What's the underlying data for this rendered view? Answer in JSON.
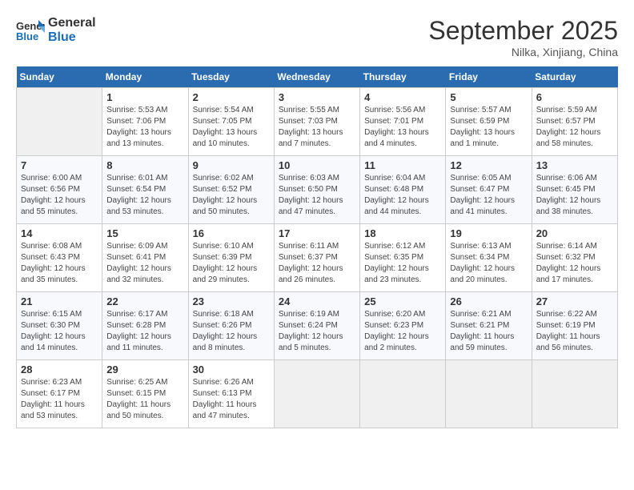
{
  "logo": {
    "line1": "General",
    "line2": "Blue"
  },
  "title": "September 2025",
  "subtitle": "Nilka, Xinjiang, China",
  "days_header": [
    "Sunday",
    "Monday",
    "Tuesday",
    "Wednesday",
    "Thursday",
    "Friday",
    "Saturday"
  ],
  "weeks": [
    [
      {
        "num": "",
        "info": ""
      },
      {
        "num": "1",
        "info": "Sunrise: 5:53 AM\nSunset: 7:06 PM\nDaylight: 13 hours\nand 13 minutes."
      },
      {
        "num": "2",
        "info": "Sunrise: 5:54 AM\nSunset: 7:05 PM\nDaylight: 13 hours\nand 10 minutes."
      },
      {
        "num": "3",
        "info": "Sunrise: 5:55 AM\nSunset: 7:03 PM\nDaylight: 13 hours\nand 7 minutes."
      },
      {
        "num": "4",
        "info": "Sunrise: 5:56 AM\nSunset: 7:01 PM\nDaylight: 13 hours\nand 4 minutes."
      },
      {
        "num": "5",
        "info": "Sunrise: 5:57 AM\nSunset: 6:59 PM\nDaylight: 13 hours\nand 1 minute."
      },
      {
        "num": "6",
        "info": "Sunrise: 5:59 AM\nSunset: 6:57 PM\nDaylight: 12 hours\nand 58 minutes."
      }
    ],
    [
      {
        "num": "7",
        "info": "Sunrise: 6:00 AM\nSunset: 6:56 PM\nDaylight: 12 hours\nand 55 minutes."
      },
      {
        "num": "8",
        "info": "Sunrise: 6:01 AM\nSunset: 6:54 PM\nDaylight: 12 hours\nand 53 minutes."
      },
      {
        "num": "9",
        "info": "Sunrise: 6:02 AM\nSunset: 6:52 PM\nDaylight: 12 hours\nand 50 minutes."
      },
      {
        "num": "10",
        "info": "Sunrise: 6:03 AM\nSunset: 6:50 PM\nDaylight: 12 hours\nand 47 minutes."
      },
      {
        "num": "11",
        "info": "Sunrise: 6:04 AM\nSunset: 6:48 PM\nDaylight: 12 hours\nand 44 minutes."
      },
      {
        "num": "12",
        "info": "Sunrise: 6:05 AM\nSunset: 6:47 PM\nDaylight: 12 hours\nand 41 minutes."
      },
      {
        "num": "13",
        "info": "Sunrise: 6:06 AM\nSunset: 6:45 PM\nDaylight: 12 hours\nand 38 minutes."
      }
    ],
    [
      {
        "num": "14",
        "info": "Sunrise: 6:08 AM\nSunset: 6:43 PM\nDaylight: 12 hours\nand 35 minutes."
      },
      {
        "num": "15",
        "info": "Sunrise: 6:09 AM\nSunset: 6:41 PM\nDaylight: 12 hours\nand 32 minutes."
      },
      {
        "num": "16",
        "info": "Sunrise: 6:10 AM\nSunset: 6:39 PM\nDaylight: 12 hours\nand 29 minutes."
      },
      {
        "num": "17",
        "info": "Sunrise: 6:11 AM\nSunset: 6:37 PM\nDaylight: 12 hours\nand 26 minutes."
      },
      {
        "num": "18",
        "info": "Sunrise: 6:12 AM\nSunset: 6:35 PM\nDaylight: 12 hours\nand 23 minutes."
      },
      {
        "num": "19",
        "info": "Sunrise: 6:13 AM\nSunset: 6:34 PM\nDaylight: 12 hours\nand 20 minutes."
      },
      {
        "num": "20",
        "info": "Sunrise: 6:14 AM\nSunset: 6:32 PM\nDaylight: 12 hours\nand 17 minutes."
      }
    ],
    [
      {
        "num": "21",
        "info": "Sunrise: 6:15 AM\nSunset: 6:30 PM\nDaylight: 12 hours\nand 14 minutes."
      },
      {
        "num": "22",
        "info": "Sunrise: 6:17 AM\nSunset: 6:28 PM\nDaylight: 12 hours\nand 11 minutes."
      },
      {
        "num": "23",
        "info": "Sunrise: 6:18 AM\nSunset: 6:26 PM\nDaylight: 12 hours\nand 8 minutes."
      },
      {
        "num": "24",
        "info": "Sunrise: 6:19 AM\nSunset: 6:24 PM\nDaylight: 12 hours\nand 5 minutes."
      },
      {
        "num": "25",
        "info": "Sunrise: 6:20 AM\nSunset: 6:23 PM\nDaylight: 12 hours\nand 2 minutes."
      },
      {
        "num": "26",
        "info": "Sunrise: 6:21 AM\nSunset: 6:21 PM\nDaylight: 11 hours\nand 59 minutes."
      },
      {
        "num": "27",
        "info": "Sunrise: 6:22 AM\nSunset: 6:19 PM\nDaylight: 11 hours\nand 56 minutes."
      }
    ],
    [
      {
        "num": "28",
        "info": "Sunrise: 6:23 AM\nSunset: 6:17 PM\nDaylight: 11 hours\nand 53 minutes."
      },
      {
        "num": "29",
        "info": "Sunrise: 6:25 AM\nSunset: 6:15 PM\nDaylight: 11 hours\nand 50 minutes."
      },
      {
        "num": "30",
        "info": "Sunrise: 6:26 AM\nSunset: 6:13 PM\nDaylight: 11 hours\nand 47 minutes."
      },
      {
        "num": "",
        "info": ""
      },
      {
        "num": "",
        "info": ""
      },
      {
        "num": "",
        "info": ""
      },
      {
        "num": "",
        "info": ""
      }
    ]
  ]
}
